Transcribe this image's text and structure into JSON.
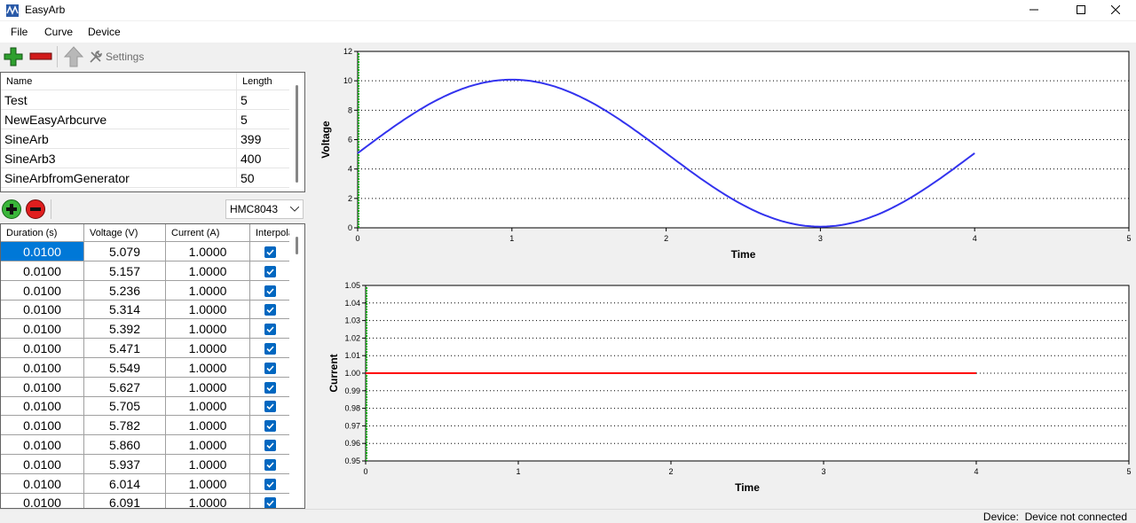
{
  "window": {
    "title": "EasyArb"
  },
  "menu": [
    "File",
    "Curve",
    "Device"
  ],
  "toolbar": {
    "settings_label": "Settings"
  },
  "curves": {
    "columns": [
      "Name",
      "Length"
    ],
    "rows": [
      {
        "name": "Test",
        "length": "5"
      },
      {
        "name": "NewEasyArbcurve",
        "length": "5"
      },
      {
        "name": "SineArb",
        "length": "399"
      },
      {
        "name": "SineArb3",
        "length": "400"
      },
      {
        "name": "SineArbfromGenerator",
        "length": "50"
      }
    ]
  },
  "device_select": {
    "value": "HMC8043"
  },
  "points": {
    "columns": [
      "Duration (s)",
      "Voltage (V)",
      "Current (A)",
      "Interpolation"
    ],
    "rows": [
      {
        "duration": "0.0100",
        "voltage": "5.079",
        "current": "1.0000",
        "interp": true
      },
      {
        "duration": "0.0100",
        "voltage": "5.157",
        "current": "1.0000",
        "interp": true
      },
      {
        "duration": "0.0100",
        "voltage": "5.236",
        "current": "1.0000",
        "interp": true
      },
      {
        "duration": "0.0100",
        "voltage": "5.314",
        "current": "1.0000",
        "interp": true
      },
      {
        "duration": "0.0100",
        "voltage": "5.392",
        "current": "1.0000",
        "interp": true
      },
      {
        "duration": "0.0100",
        "voltage": "5.471",
        "current": "1.0000",
        "interp": true
      },
      {
        "duration": "0.0100",
        "voltage": "5.549",
        "current": "1.0000",
        "interp": true
      },
      {
        "duration": "0.0100",
        "voltage": "5.627",
        "current": "1.0000",
        "interp": true
      },
      {
        "duration": "0.0100",
        "voltage": "5.705",
        "current": "1.0000",
        "interp": true
      },
      {
        "duration": "0.0100",
        "voltage": "5.782",
        "current": "1.0000",
        "interp": true
      },
      {
        "duration": "0.0100",
        "voltage": "5.860",
        "current": "1.0000",
        "interp": true
      },
      {
        "duration": "0.0100",
        "voltage": "5.937",
        "current": "1.0000",
        "interp": true
      },
      {
        "duration": "0.0100",
        "voltage": "6.014",
        "current": "1.0000",
        "interp": true
      },
      {
        "duration": "0.0100",
        "voltage": "6.091",
        "current": "1.0000",
        "interp": true
      }
    ]
  },
  "status": {
    "label": "Device:",
    "value": "Device not connected"
  },
  "colors": {
    "selection": "#0078d7",
    "voltage_line": "#3333ee",
    "current_line": "#ff0000",
    "cursor": "#00aa00"
  },
  "chart_data": [
    {
      "type": "line",
      "ylabel": "Voltage",
      "xlabel": "Time",
      "xlim": [
        0,
        5
      ],
      "ylim": [
        0,
        12
      ],
      "xticks": [
        0,
        1,
        2,
        3,
        4,
        5
      ],
      "yticks": [
        0,
        2,
        4,
        6,
        8,
        10,
        12
      ],
      "grid": "dotted",
      "series": [
        {
          "function": "sine",
          "offset": 5.079,
          "amplitude": 5,
          "period": 4,
          "x_range": [
            0,
            4
          ]
        }
      ]
    },
    {
      "type": "line",
      "ylabel": "Current",
      "xlabel": "Time",
      "xlim": [
        0,
        5
      ],
      "ylim": [
        0.95,
        1.05
      ],
      "xticks": [
        0,
        1,
        2,
        3,
        4,
        5
      ],
      "yticks": [
        "0.95",
        "0.96",
        "0.97",
        "0.98",
        "0.99",
        "1.00",
        "1.01",
        "1.02",
        "1.03",
        "1.04",
        "1.05"
      ],
      "grid": "dotted",
      "series": [
        {
          "x": [
            0,
            4
          ],
          "y": [
            1.0,
            1.0
          ]
        }
      ]
    }
  ]
}
